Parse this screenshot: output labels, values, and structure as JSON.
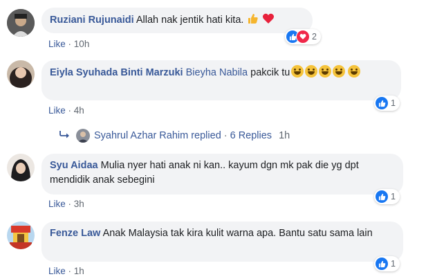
{
  "comments": [
    {
      "author": "Ruziani Rujunaidi",
      "text": "Allah nak jentik hati kita.",
      "emojis": [
        "thumbs-up",
        "heart"
      ],
      "like_label": "Like",
      "time": "10h",
      "reaction_count": "2",
      "reactions": [
        "like",
        "heart"
      ]
    },
    {
      "author": "Eiyla Syuhada Binti Marzuki",
      "tag": "Bieyha Nabila",
      "text": "pakcik tu",
      "emojis": [
        "laughing",
        "laughing",
        "laughing",
        "laughing",
        "laughing"
      ],
      "like_label": "Like",
      "time": "4h",
      "reaction_count": "1",
      "reactions": [
        "like"
      ]
    },
    {
      "author": "Syu Aidaa",
      "text": "Mulia nyer hati anak ni kan.. kayum dgn mk pak die yg dpt mendidik anak sebegini",
      "like_label": "Like",
      "time": "3h",
      "reaction_count": "1",
      "reactions": [
        "like"
      ]
    },
    {
      "author": "Fenze Law",
      "text": "Anak Malaysia tak kira kulit warna apa. Bantu satu sama lain",
      "like_label": "Like",
      "time": "1h",
      "reaction_count": "1",
      "reactions": [
        "like"
      ]
    }
  ],
  "replies": {
    "name": "Syahrul Azhar Rahim replied",
    "separator": "·",
    "count": "6 Replies",
    "time": "1h"
  },
  "meta_separator": "·",
  "colors": {
    "link": "#385898",
    "bubble": "#f2f3f5",
    "like_blue": "#1877f2",
    "heart_red": "#f0284a"
  }
}
